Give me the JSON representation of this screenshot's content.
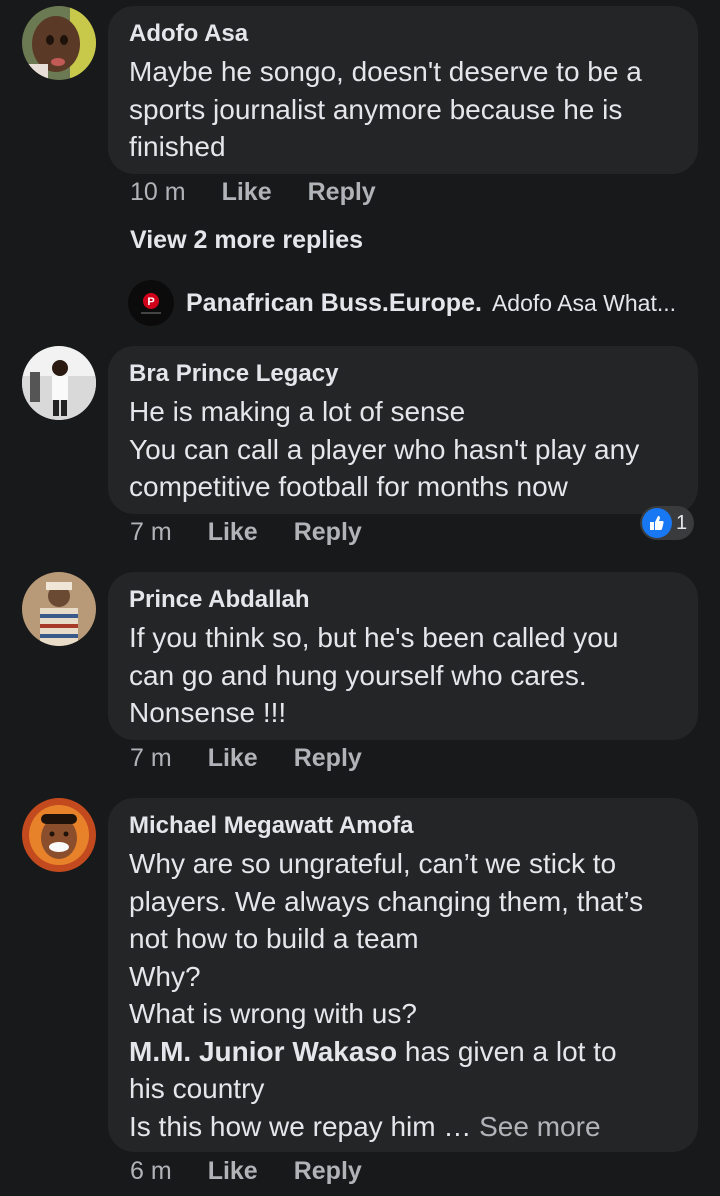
{
  "colors": {
    "background": "#18191a",
    "bubble": "#242526",
    "text": "#e4e6eb",
    "secondary": "#b0b3b8",
    "like_blue": "#1877f2",
    "page_red": "#d0021b"
  },
  "comments": [
    {
      "author": "Adofo Asa",
      "lines": [
        "Maybe he songo, doesn't deserve to be a",
        "sports journalist anymore because he is",
        "finished"
      ],
      "time": "10 m",
      "like": "Like",
      "reply": "Reply"
    },
    {
      "author": "Bra Prince Legacy",
      "lines": [
        "He is making a lot of sense",
        "You can call a player who hasn't play any",
        "competitive football for months now"
      ],
      "time": "7 m",
      "like": "Like",
      "reply": "Reply",
      "reaction_count": "1",
      "reaction_icon": "thumbs-up-icon"
    },
    {
      "author": "Prince Abdallah",
      "lines": [
        "If you think so,  but he's been called you",
        "can go and hung yourself who cares.",
        "Nonsense !!!"
      ],
      "time": "7 m",
      "like": "Like",
      "reply": "Reply"
    },
    {
      "author": "Michael Megawatt Amofa",
      "lines": [
        "Why are so ungrateful, can’t we stick to",
        "players. We always changing them, that’s",
        "not how to build a team",
        "Why?",
        "What is wrong with us?"
      ],
      "mention": "M.M. Junior Wakaso",
      "mention_rest": " has given a lot to",
      "lines2": [
        "his country"
      ],
      "last_line": "Is this how we repay him … ",
      "see_more": "See more",
      "time": "6 m",
      "like": "Like",
      "reply": "Reply"
    }
  ],
  "view_more_replies": "View 2 more replies",
  "reply_preview": {
    "author": "Panafrican  Buss.Europe.",
    "snippet": "Adofo Asa What..."
  }
}
